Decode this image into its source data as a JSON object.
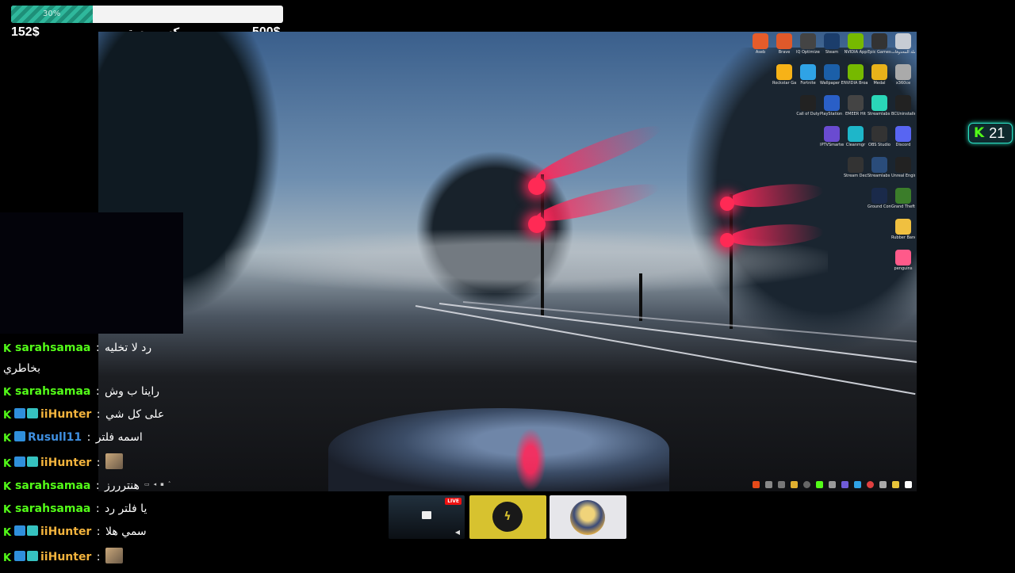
{
  "goal": {
    "fill_fraction": 0.3,
    "percent_label": "30%",
    "current": "152$",
    "target": "500$",
    "title": "مكسر وستريم ديك"
  },
  "viewer_counter": {
    "icon": "kick-icon",
    "count": "21"
  },
  "desktop": {
    "icons": [
      {
        "label": "Aseb",
        "icon": "app-icon"
      },
      {
        "label": "Brave",
        "icon": "brave-icon"
      },
      {
        "label": "IQ Optimizer",
        "icon": "app-icon"
      },
      {
        "label": "Steam",
        "icon": "steam-icon"
      },
      {
        "label": "NVIDIA App",
        "icon": "nvidia-icon"
      },
      {
        "label": "Epic Games Launcher",
        "icon": "epic-icon"
      },
      {
        "label": "سلة المحذوفات",
        "icon": "recycle-bin-icon"
      },
      {
        "label": "Rockstar Games",
        "icon": "rockstar-icon"
      },
      {
        "label": "Fortnite",
        "icon": "fortnite-icon"
      },
      {
        "label": "Wallpaper Engine",
        "icon": "wallpaper-icon"
      },
      {
        "label": "NVIDIA Broadcast",
        "icon": "nvidia-icon"
      },
      {
        "label": "Medal",
        "icon": "medal-icon"
      },
      {
        "label": "x360ce",
        "icon": "controller-icon"
      },
      {
        "label": "Call of Duty",
        "icon": "cod-icon"
      },
      {
        "label": "PlayStation Accessories",
        "icon": "playstation-icon"
      },
      {
        "label": "EMEER Hit",
        "icon": "app-icon"
      },
      {
        "label": "Streamlabs Desktop",
        "icon": "streamlabs-icon"
      },
      {
        "label": "BCUninstaller",
        "icon": "app-icon"
      },
      {
        "label": "IPTVSmarters",
        "icon": "iptv-icon"
      },
      {
        "label": "Cleanmgr",
        "icon": "app-icon"
      },
      {
        "label": "OBS Studio",
        "icon": "obs-icon"
      },
      {
        "label": "Discord",
        "icon": "discord-icon"
      },
      {
        "label": "Stream Deck",
        "icon": "streamdeck-icon"
      },
      {
        "label": "Streamlabs SE Link",
        "icon": "app-icon"
      },
      {
        "label": "Unreal Engine",
        "icon": "unreal-icon"
      },
      {
        "label": "Ground Control",
        "icon": "app-icon"
      },
      {
        "label": "Grand Theft Auto V Le...",
        "icon": "gta-icon"
      },
      {
        "label": "Rubber Bandits",
        "icon": "game-icon"
      },
      {
        "label": "penguins",
        "icon": "game-icon"
      }
    ]
  },
  "chat": {
    "messages": [
      {
        "badges": [],
        "user": "sarahsamaa",
        "user_color": "#53fc18",
        "text": "رد لا تخليه",
        "text2": "بخاطري"
      },
      {
        "badges": [],
        "user": "sarahsamaa",
        "user_color": "#53fc18",
        "text": "راينا ب وش"
      },
      {
        "badges": [
          "blue",
          "teal"
        ],
        "user": "iiHunter",
        "user_color": "#f2b33d",
        "text": "على كل شي"
      },
      {
        "badges": [
          "blue"
        ],
        "user": "Rusull11",
        "user_color": "#3f8fe0",
        "text": "اسمه فلتر"
      },
      {
        "badges": [
          "blue",
          "teal"
        ],
        "user": "iiHunter",
        "user_color": "#f2b33d",
        "emote": "emote-icon"
      },
      {
        "badges": [],
        "user": "sarahsamaa",
        "user_color": "#53fc18",
        "text": "هنترررز"
      },
      {
        "badges": [],
        "user": "sarahsamaa",
        "user_color": "#53fc18",
        "text": "يا فلتر رد"
      },
      {
        "badges": [
          "blue",
          "teal"
        ],
        "user": "iiHunter",
        "user_color": "#f2b33d",
        "text": "سمي هلا"
      },
      {
        "badges": [
          "blue",
          "teal"
        ],
        "user": "iiHunter",
        "user_color": "#f2b33d",
        "emote": "emote-icon"
      }
    ],
    "separator": ":"
  },
  "thumbnails": [
    {
      "name": "desktop-scene",
      "live": "LIVE"
    },
    {
      "name": "yellow-logo"
    },
    {
      "name": "avatar-art"
    }
  ]
}
